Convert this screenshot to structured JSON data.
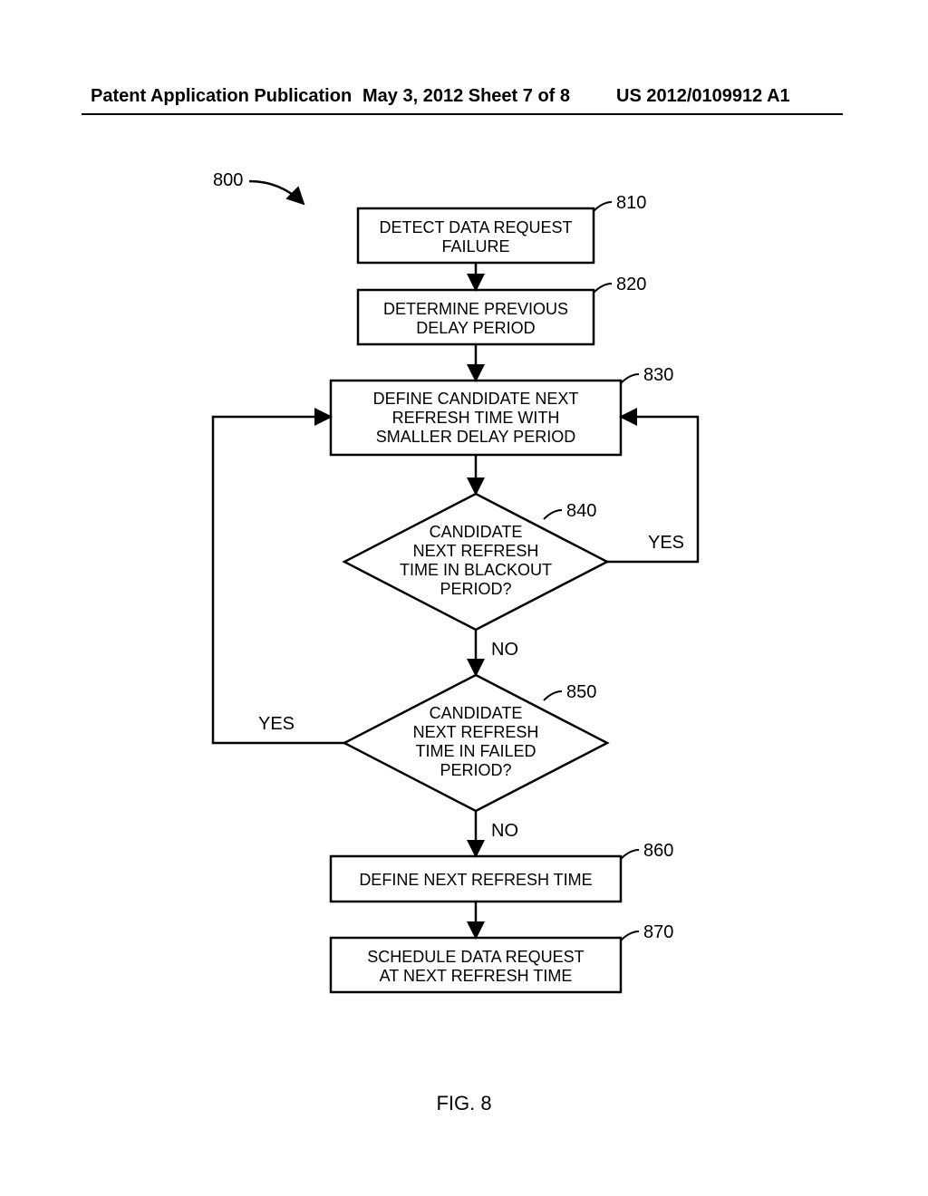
{
  "header": {
    "left": "Patent Application Publication",
    "center": "May 3, 2012  Sheet 7 of 8",
    "right": "US 2012/0109912 A1"
  },
  "labels": {
    "flow": "800",
    "b810": "810",
    "b820": "820",
    "b830": "830",
    "d840": "840",
    "d850": "850",
    "b860": "860",
    "b870": "870",
    "yes840": "YES",
    "no840": "NO",
    "yes850": "YES",
    "no850": "NO"
  },
  "boxes": {
    "b810l1": "DETECT DATA REQUEST",
    "b810l2": "FAILURE",
    "b820l1": "DETERMINE PREVIOUS",
    "b820l2": "DELAY PERIOD",
    "b830l1": "DEFINE CANDIDATE NEXT",
    "b830l2": "REFRESH TIME WITH",
    "b830l3": "SMALLER DELAY PERIOD",
    "d840l1": "CANDIDATE",
    "d840l2": "NEXT REFRESH",
    "d840l3": "TIME IN BLACKOUT",
    "d840l4": "PERIOD?",
    "d850l1": "CANDIDATE",
    "d850l2": "NEXT REFRESH",
    "d850l3": "TIME IN FAILED",
    "d850l4": "PERIOD?",
    "b860": "DEFINE NEXT REFRESH TIME",
    "b870l1": "SCHEDULE DATA REQUEST",
    "b870l2": "AT NEXT REFRESH TIME"
  },
  "figure": "FIG. 8"
}
